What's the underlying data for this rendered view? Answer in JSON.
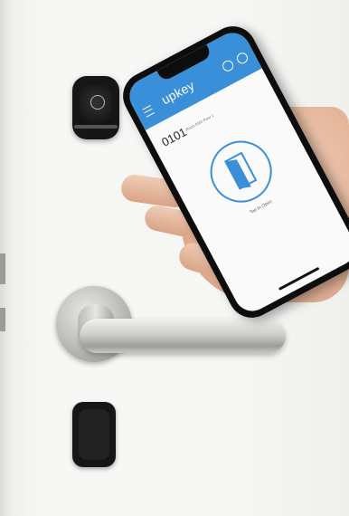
{
  "image": {
    "subject": "smart lock",
    "colors": {
      "background": "#f4f4f2",
      "app_accent": "#3a8fd9",
      "hardware_dark": "#151515",
      "steel": "#c3c3c0"
    }
  },
  "phone_app": {
    "title": "upkey",
    "lock_name": "0101",
    "lock_subtitle": "Room 0101 Floor 1",
    "action_label": "Tap to Open",
    "icons": {
      "menu": "menu-icon",
      "phone": "phone-icon",
      "settings": "settings-icon",
      "door": "door-icon"
    }
  },
  "hardware": {
    "reader_icon": "fingerprint-icon"
  }
}
